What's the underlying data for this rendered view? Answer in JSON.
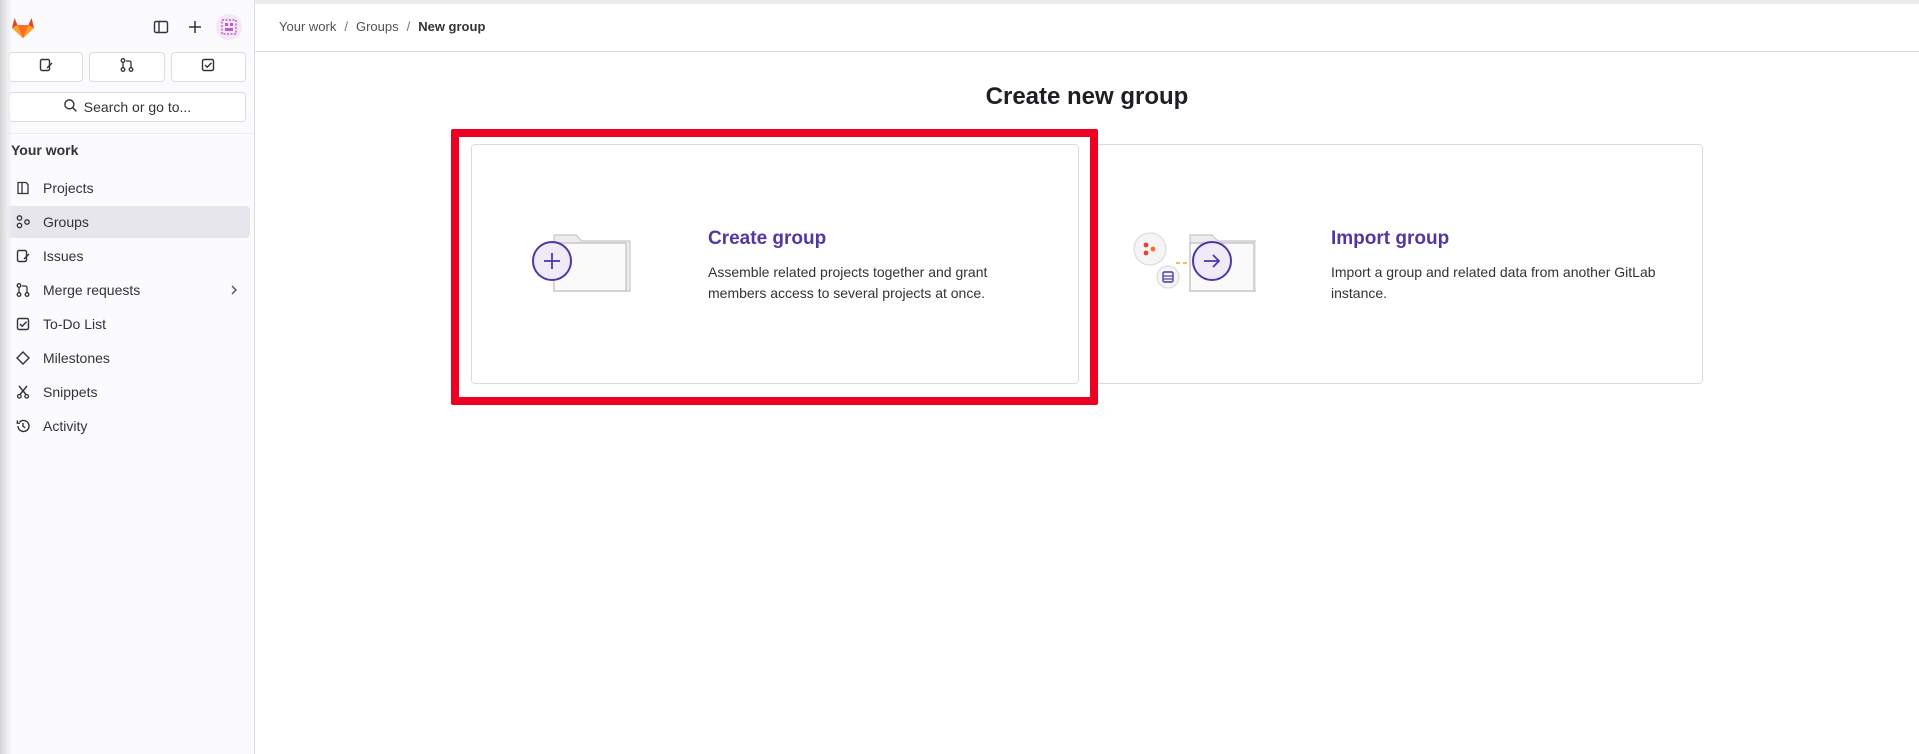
{
  "sidebar": {
    "quick_actions": [
      "issues-icon",
      "merge-request-icon",
      "todo-icon"
    ],
    "search_label": "Search or go to...",
    "section_title": "Your work",
    "items": [
      {
        "label": "Projects",
        "icon": "project-icon"
      },
      {
        "label": "Groups",
        "icon": "group-icon",
        "active": true
      },
      {
        "label": "Issues",
        "icon": "issues-icon"
      },
      {
        "label": "Merge requests",
        "icon": "merge-request-icon"
      },
      {
        "label": "To-Do List",
        "icon": "todo-icon"
      },
      {
        "label": "Milestones",
        "icon": "milestone-icon"
      },
      {
        "label": "Snippets",
        "icon": "snippet-icon"
      },
      {
        "label": "Activity",
        "icon": "history-icon"
      }
    ]
  },
  "breadcrumb": {
    "items": [
      "Your work",
      "Groups"
    ],
    "current": "New group",
    "separator": "/"
  },
  "main": {
    "title": "Create new group",
    "cards": [
      {
        "title": "Create group",
        "description": "Assemble related projects together and grant members access to several projects at once."
      },
      {
        "title": "Import group",
        "description": "Import a group and related data from another GitLab instance."
      }
    ]
  },
  "colors": {
    "accent": "#5237a1",
    "highlight": "#ee0022",
    "active_indicator": "#1f75cb",
    "logo_orange": "#e24329"
  }
}
